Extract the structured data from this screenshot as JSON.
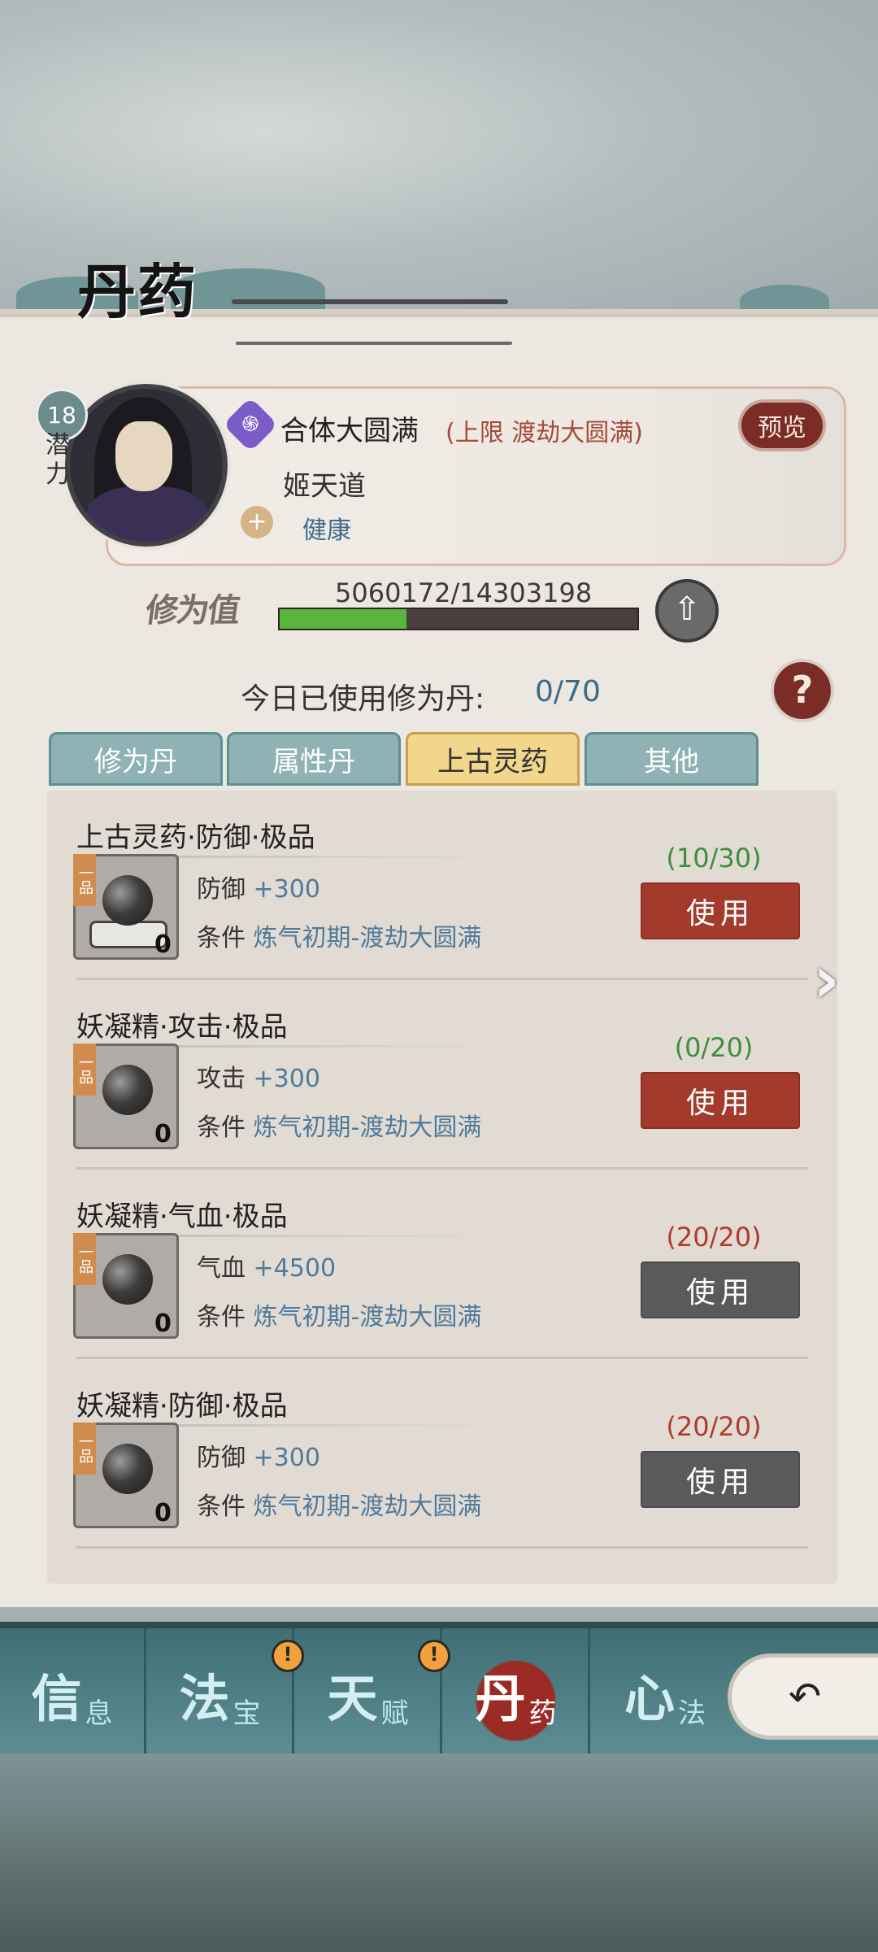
{
  "header": {
    "title": "丹药"
  },
  "character": {
    "level": "18",
    "potential_label": "潜力",
    "realm": "合体大圆满",
    "realm_limit": "(上限 渡劫大圆满)",
    "preview_label": "预览",
    "name": "姬天道",
    "health_status": "健康",
    "realm_icon": "swirl-icon",
    "health_icon": "heart-plus-icon"
  },
  "cultivation": {
    "label": "修为值",
    "value_text": "5060172/14303198",
    "progress": 0.354,
    "upgrade_icon": "up-arrow-icon"
  },
  "usage": {
    "label": "今日已使用修为丹:",
    "value": "0/70",
    "help_icon": "question-icon"
  },
  "tabs": [
    {
      "label": "修为丹",
      "active": false
    },
    {
      "label": "属性丹",
      "active": false
    },
    {
      "label": "上古灵药",
      "active": true
    },
    {
      "label": "其他",
      "active": false
    }
  ],
  "items": [
    {
      "title": "上古灵药·防御·极品",
      "grade": "一品",
      "count": "0",
      "stat_name": "防御",
      "stat_value": "+300",
      "cond_label": "条件",
      "cond_value": "炼气初期-渡劫大圆满",
      "uses": "(10/30)",
      "uses_color": "#3c8f3c",
      "button": "使用",
      "button_enabled": true
    },
    {
      "title": "妖凝精·攻击·极品",
      "grade": "一品",
      "count": "0",
      "stat_name": "攻击",
      "stat_value": "+300",
      "cond_label": "条件",
      "cond_value": "炼气初期-渡劫大圆满",
      "uses": "(0/20)",
      "uses_color": "#3c8f3c",
      "button": "使用",
      "button_enabled": true
    },
    {
      "title": "妖凝精·气血·极品",
      "grade": "一品",
      "count": "0",
      "stat_name": "气血",
      "stat_value": "+4500",
      "cond_label": "条件",
      "cond_value": "炼气初期-渡劫大圆满",
      "uses": "(20/20)",
      "uses_color": "#b23a2e",
      "button": "使用",
      "button_enabled": false
    },
    {
      "title": "妖凝精·防御·极品",
      "grade": "一品",
      "count": "0",
      "stat_name": "防御",
      "stat_value": "+300",
      "cond_label": "条件",
      "cond_value": "炼气初期-渡劫大圆满",
      "uses": "(20/20)",
      "uses_color": "#b23a2e",
      "button": "使用",
      "button_enabled": false
    }
  ],
  "nav": [
    {
      "big": "信",
      "small": "息",
      "alert": false,
      "active": false
    },
    {
      "big": "法",
      "small": "宝",
      "alert": true,
      "active": false
    },
    {
      "big": "天",
      "small": "赋",
      "alert": true,
      "active": false
    },
    {
      "big": "丹",
      "small": "药",
      "alert": false,
      "active": true
    },
    {
      "big": "心",
      "small": "法",
      "alert": false,
      "active": false
    }
  ],
  "colors": {
    "enabled_button": "#a33a2c",
    "disabled_button": "#5a5a5a",
    "accent_blue": "#4f7a9b"
  }
}
